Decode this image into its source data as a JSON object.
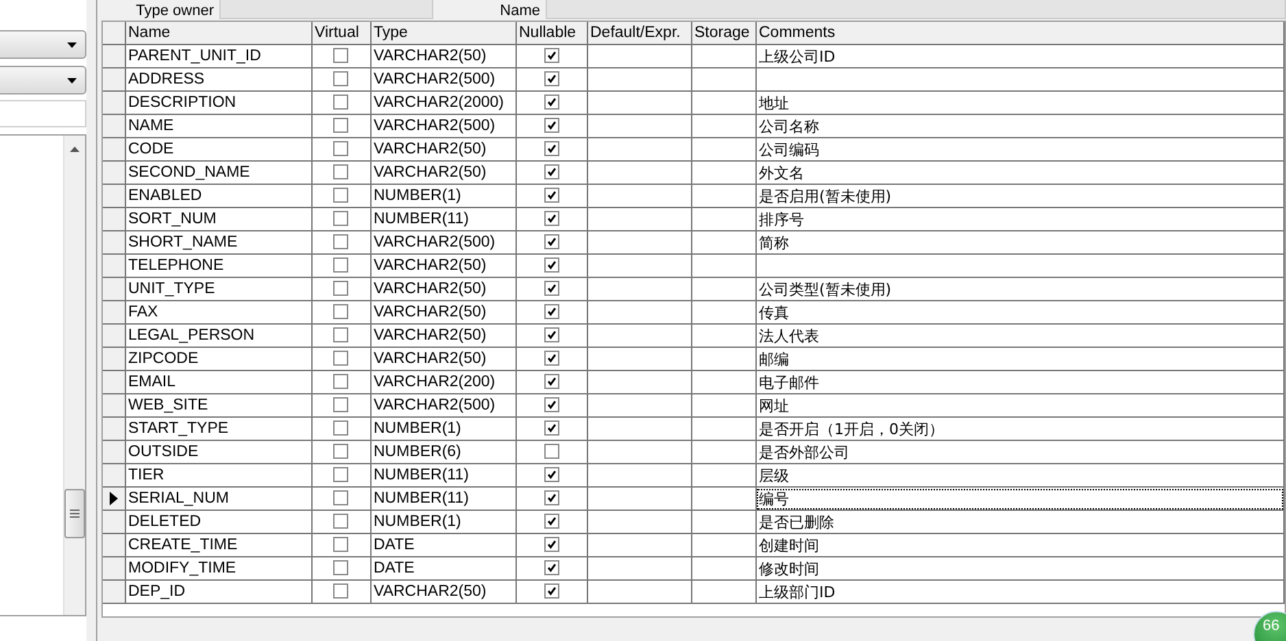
{
  "header_fields": [
    {
      "label": "Type owner"
    },
    {
      "label": "Name"
    }
  ],
  "columns_table": {
    "columns": [
      "Name",
      "Virtual",
      "Type",
      "Nullable",
      "Default/Expr.",
      "Storage",
      "Comments"
    ],
    "rows": [
      {
        "name": "PARENT_UNIT_ID",
        "virtual": false,
        "type": "VARCHAR2(50)",
        "nullable": true,
        "comments": "上级公司ID",
        "selected": false
      },
      {
        "name": "ADDRESS",
        "virtual": false,
        "type": "VARCHAR2(500)",
        "nullable": true,
        "selected": false
      },
      {
        "name": "DESCRIPTION",
        "virtual": false,
        "type": "VARCHAR2(2000)",
        "nullable": true,
        "comments": "地址",
        "selected": false
      },
      {
        "name": "NAME",
        "virtual": false,
        "type": "VARCHAR2(500)",
        "nullable": true,
        "comments": "公司名称",
        "selected": false
      },
      {
        "name": "CODE",
        "virtual": false,
        "type": "VARCHAR2(50)",
        "nullable": true,
        "comments": "公司编码",
        "selected": false
      },
      {
        "name": "SECOND_NAME",
        "virtual": false,
        "type": "VARCHAR2(50)",
        "nullable": true,
        "comments": "外文名",
        "selected": false
      },
      {
        "name": "ENABLED",
        "virtual": false,
        "type": "NUMBER(1)",
        "nullable": true,
        "comments": "是否启用(暂未使用)",
        "selected": false
      },
      {
        "name": "SORT_NUM",
        "virtual": false,
        "type": "NUMBER(11)",
        "nullable": true,
        "comments": "排序号",
        "selected": false
      },
      {
        "name": "SHORT_NAME",
        "virtual": false,
        "type": "VARCHAR2(500)",
        "nullable": true,
        "comments": "简称",
        "selected": false
      },
      {
        "name": "TELEPHONE",
        "virtual": false,
        "type": "VARCHAR2(50)",
        "nullable": true,
        "selected": false
      },
      {
        "name": "UNIT_TYPE",
        "virtual": false,
        "type": "VARCHAR2(50)",
        "nullable": true,
        "comments": "公司类型(暂未使用)",
        "selected": false
      },
      {
        "name": "FAX",
        "virtual": false,
        "type": "VARCHAR2(50)",
        "nullable": true,
        "comments": "传真",
        "selected": false
      },
      {
        "name": "LEGAL_PERSON",
        "virtual": false,
        "type": "VARCHAR2(50)",
        "nullable": true,
        "comments": "法人代表",
        "selected": false
      },
      {
        "name": "ZIPCODE",
        "virtual": false,
        "type": "VARCHAR2(50)",
        "nullable": true,
        "comments": "邮编",
        "selected": false
      },
      {
        "name": "EMAIL",
        "virtual": false,
        "type": "VARCHAR2(200)",
        "nullable": true,
        "comments": "电子邮件",
        "selected": false
      },
      {
        "name": "WEB_SITE",
        "virtual": false,
        "type": "VARCHAR2(500)",
        "nullable": true,
        "comments": "网址",
        "selected": false
      },
      {
        "name": "START_TYPE",
        "virtual": false,
        "type": "NUMBER(1)",
        "nullable": true,
        "comments": "是否开启（1开启，0关闭）",
        "selected": false
      },
      {
        "name": "OUTSIDE",
        "virtual": false,
        "type": "NUMBER(6)",
        "nullable": false,
        "comments": "是否外部公司",
        "selected": false
      },
      {
        "name": "TIER",
        "virtual": false,
        "type": "NUMBER(11)",
        "nullable": true,
        "comments": "层级",
        "selected": false
      },
      {
        "name": "SERIAL_NUM",
        "virtual": false,
        "type": "NUMBER(11)",
        "nullable": true,
        "comments": "编号",
        "selected": true
      },
      {
        "name": "DELETED",
        "virtual": false,
        "type": "NUMBER(1)",
        "nullable": true,
        "comments": "是否已删除",
        "selected": false
      },
      {
        "name": "CREATE_TIME",
        "virtual": false,
        "type": "DATE",
        "nullable": true,
        "comments": "创建时间",
        "selected": false
      },
      {
        "name": "MODIFY_TIME",
        "virtual": false,
        "type": "DATE",
        "nullable": true,
        "comments": "修改时间",
        "selected": false
      },
      {
        "name": "DEP_ID",
        "virtual": false,
        "type": "VARCHAR2(50)",
        "nullable": true,
        "comments": "上级部门ID",
        "selected": false
      }
    ]
  },
  "badge": {
    "text": "66"
  }
}
